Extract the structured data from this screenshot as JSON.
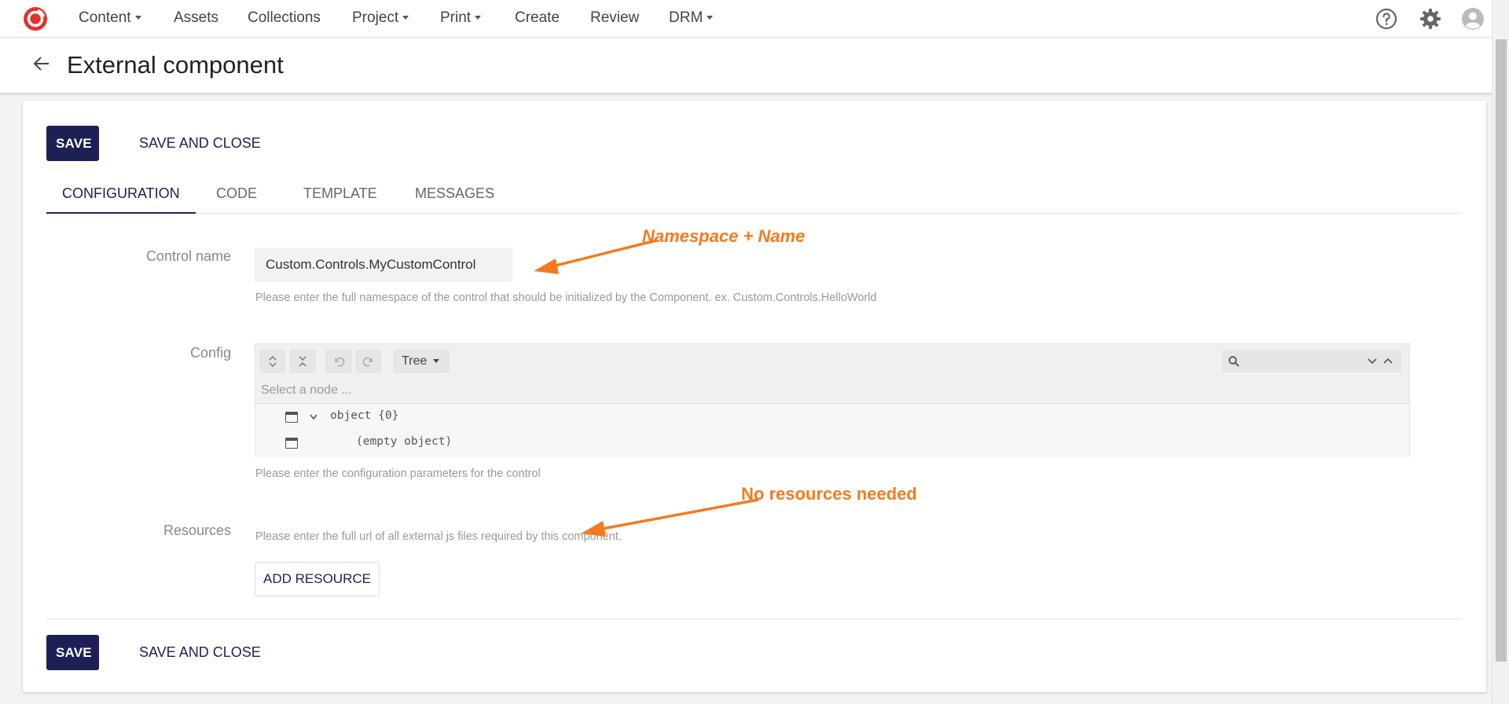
{
  "nav": {
    "items": [
      {
        "label": "Content",
        "caret": true
      },
      {
        "label": "Assets",
        "caret": false
      },
      {
        "label": "Collections",
        "caret": false
      },
      {
        "label": "Project",
        "caret": true
      },
      {
        "label": "Print",
        "caret": true
      },
      {
        "label": "Create",
        "caret": false
      },
      {
        "label": "Review",
        "caret": false
      },
      {
        "label": "DRM",
        "caret": true
      }
    ],
    "icons": [
      "help-icon",
      "gear-icon",
      "user-avatar-icon"
    ]
  },
  "header": {
    "title": "External component"
  },
  "toolbar": {
    "save_label": "SAVE",
    "save_close_label": "SAVE AND CLOSE"
  },
  "tabs": [
    {
      "label": "CONFIGURATION",
      "active": true
    },
    {
      "label": "CODE",
      "active": false
    },
    {
      "label": "TEMPLATE",
      "active": false
    },
    {
      "label": "MESSAGES",
      "active": false
    }
  ],
  "form": {
    "control_name": {
      "label": "Control name",
      "value": "Custom.Controls.MyCustomControl",
      "hint": "Please enter the full namespace of the control that should be initialized by the Component. ex. Custom.Controls.HelloWorld"
    },
    "config": {
      "label": "Config",
      "mode": "Tree",
      "navigation_placeholder": "Select a node ...",
      "tree": [
        {
          "text": "object {0}",
          "expandable": true
        },
        {
          "text": "(empty object)",
          "expandable": false
        }
      ],
      "hint": "Please enter the configuration parameters for the control"
    },
    "resources": {
      "label": "Resources",
      "hint": "Please enter the full url of all external js files required by this component.",
      "add_label": "ADD RESOURCE"
    }
  },
  "annotations": {
    "namespace": "Namespace + Name",
    "resources": "No resources needed"
  },
  "colors": {
    "primary": "#1d1f55",
    "annotation": "#f47a20",
    "logo": "#e5322d"
  }
}
